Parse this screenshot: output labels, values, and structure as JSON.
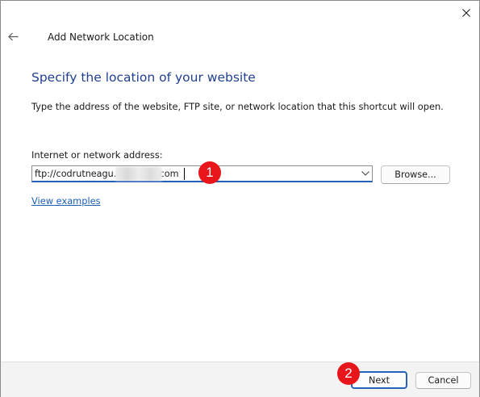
{
  "window": {
    "title": "Add Network Location",
    "close_icon": "close-icon",
    "back_icon": "back-arrow-icon"
  },
  "main": {
    "heading": "Specify the location of your website",
    "description": "Type the address of the website, FTP site, or network location that this shortcut will open.",
    "address_label": "Internet or network address:",
    "address_value": "ftp://codrutneagu.              .com",
    "browse_label": "Browse...",
    "view_examples_label": "View examples"
  },
  "footer": {
    "next_label": "Next",
    "cancel_label": "Cancel"
  },
  "annotations": {
    "step1": "1",
    "step2": "2"
  },
  "colors": {
    "heading": "#1f3f8f",
    "accent": "#2563b8",
    "link": "#1d5fb5",
    "badge": "#e8151b",
    "footer_bg": "#f3f3f3"
  }
}
